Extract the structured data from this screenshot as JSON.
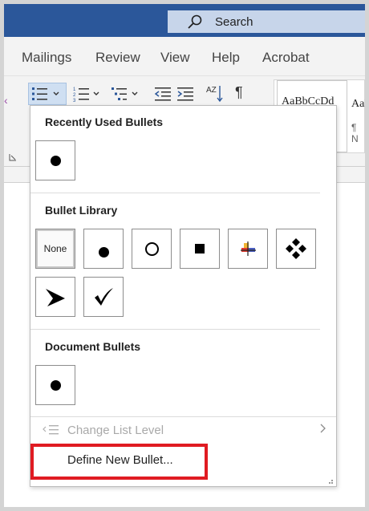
{
  "search": {
    "label": "Search",
    "icon": "search-icon"
  },
  "tabs": [
    {
      "label": "Mailings"
    },
    {
      "label": "Review"
    },
    {
      "label": "View"
    },
    {
      "label": "Help"
    },
    {
      "label": "Acrobat"
    }
  ],
  "ribbon": {
    "pilcrow": "¶",
    "sort_label": "AZ",
    "styles": [
      {
        "name": "AaBbCcDd",
        "sub": ""
      },
      {
        "name": "AaI",
        "sub": "¶ N"
      }
    ]
  },
  "dropdown": {
    "recent_title": "Recently Used Bullets",
    "library_title": "Bullet Library",
    "none_label": "None",
    "document_title": "Document Bullets",
    "change_level_label": "Change List Level",
    "define_label": "Define New Bullet..."
  },
  "colors": {
    "titlebar": "#2b579a",
    "highlight": "#e01b22",
    "ribbon": "#f3f3f3"
  }
}
